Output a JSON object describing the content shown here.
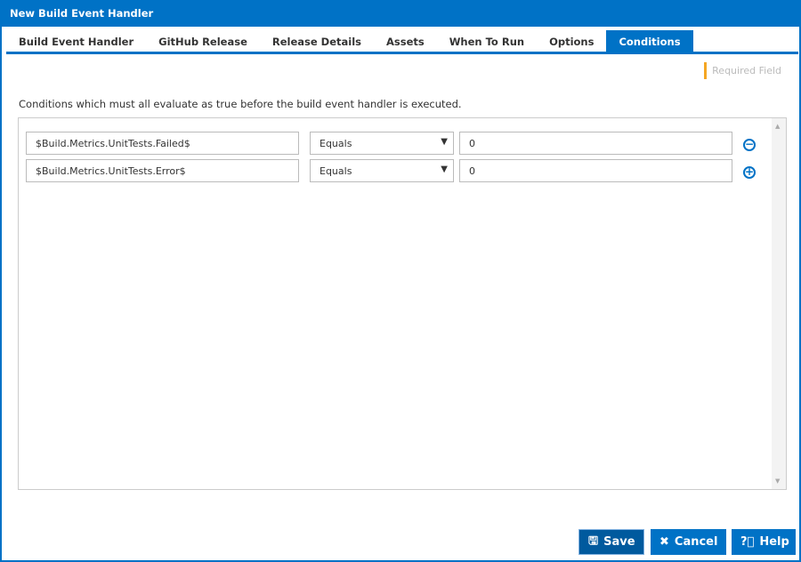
{
  "title": "New Build Event Handler",
  "tabs": [
    "Build Event Handler",
    "GitHub Release",
    "Release Details",
    "Assets",
    "When To Run",
    "Options",
    "Conditions"
  ],
  "required_field": "Required Field",
  "description": "Conditions which must all evaluate as true before the build event handler is executed.",
  "conditions": [
    {
      "field": "$Build.Metrics.UnitTests.Failed$",
      "operator": "Equals",
      "value": "0",
      "action": "remove"
    },
    {
      "field": "$Build.Metrics.UnitTests.Error$",
      "operator": "Equals",
      "value": "0",
      "action": "add"
    }
  ],
  "buttons": {
    "save": "Save",
    "cancel": "Cancel",
    "help": "Help"
  }
}
